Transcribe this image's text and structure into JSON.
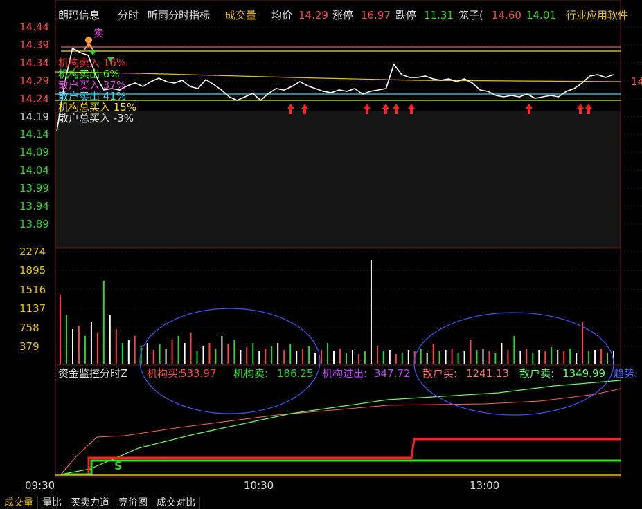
{
  "header": {
    "stock_name": "朗玛信息",
    "view": "分时",
    "indicator_name": "听雨分时指标",
    "volume_label": "成交量",
    "avg_label": "均价",
    "avg_value": "14.29",
    "limit_up_label": "涨停",
    "limit_up_value": "16.97",
    "limit_down_label": "跌停",
    "limit_down_value": "11.31",
    "cage_label": "笼子(",
    "cage_high": "14.60",
    "cage_low": "14.01",
    "sector": "行业应用软件"
  },
  "price_axis": [
    "14.44",
    "14.39",
    "14.34",
    "14.29",
    "14.24",
    "14.19",
    "14.14",
    "14.09",
    "14.04",
    "13.99",
    "13.94",
    "13.89"
  ],
  "volume_axis": [
    "2274",
    "1895",
    "1516",
    "1137",
    "758",
    "379"
  ],
  "time_axis": [
    "09:30",
    "10:30",
    "13:00"
  ],
  "right_edge_label": "14",
  "sell_marker": "卖",
  "fund_overlay": [
    {
      "label": "机构卖入 16%",
      "color": "#ff3030"
    },
    {
      "label": "机构卖出 6%",
      "color": "#30ff30"
    },
    {
      "label": "散户买入 37%",
      "color": "#e040e0"
    },
    {
      "label": "散户卖出 41%",
      "color": "#30e0ff"
    },
    {
      "label": "机构总买入 15%",
      "color": "#ffe000"
    },
    {
      "label": "散户总买入 -3%",
      "color": "#e0e0e0"
    }
  ],
  "fund_monitor": {
    "title": "资金监控分时Z",
    "inst_buy_label": "机构买:",
    "inst_buy_value": "533.97",
    "inst_sell_label": "机构卖:",
    "inst_sell_value": "186.25",
    "inst_net_label": "机构进出:",
    "inst_net_value": "347.72",
    "retail_buy_label": "散户买:",
    "retail_buy_value": "1241.13",
    "retail_sell_label": "散户卖:",
    "retail_sell_value": "1349.99",
    "trend_label": "趋势:"
  },
  "signal_s": "S",
  "bottom_tabs": [
    "成交量",
    "量比",
    "买卖力道",
    "竞价图",
    "成交对比"
  ],
  "colors": {
    "up": "#ff3333",
    "down": "#22dd22",
    "label_yellow": "#e8c000",
    "price_line": "#ffffff",
    "avg_line": "#e8c000"
  }
}
